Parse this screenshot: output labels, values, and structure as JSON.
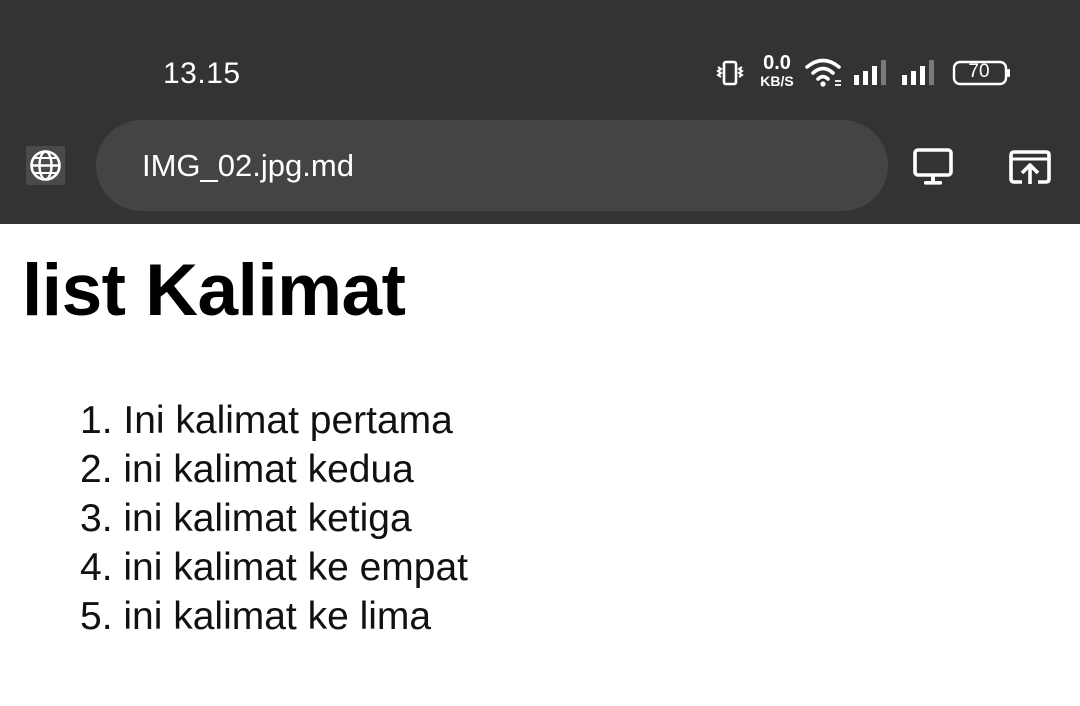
{
  "status_bar": {
    "time": "13.15",
    "net_speed_value": "0.0",
    "net_speed_unit": "KB/S",
    "battery": "70",
    "icons": [
      "vibrate-icon",
      "wifi-icon",
      "signal-icon",
      "signal-icon",
      "battery-icon"
    ]
  },
  "browser": {
    "url": "IMG_02.jpg.md",
    "site_icon": "globe-icon",
    "actions": [
      "desktop-icon",
      "open-in-app-icon"
    ]
  },
  "content": {
    "heading": "list Kalimat",
    "items": [
      "1. Ini kalimat pertama",
      "2. ini kalimat kedua",
      "3. ini kalimat ketiga",
      "4. ini kalimat ke empat",
      "5. ini kalimat ke lima"
    ]
  },
  "colors": {
    "topbar": "#333333",
    "urlbar": "#444444",
    "page_background": "#ffffff",
    "text": "#000000"
  }
}
